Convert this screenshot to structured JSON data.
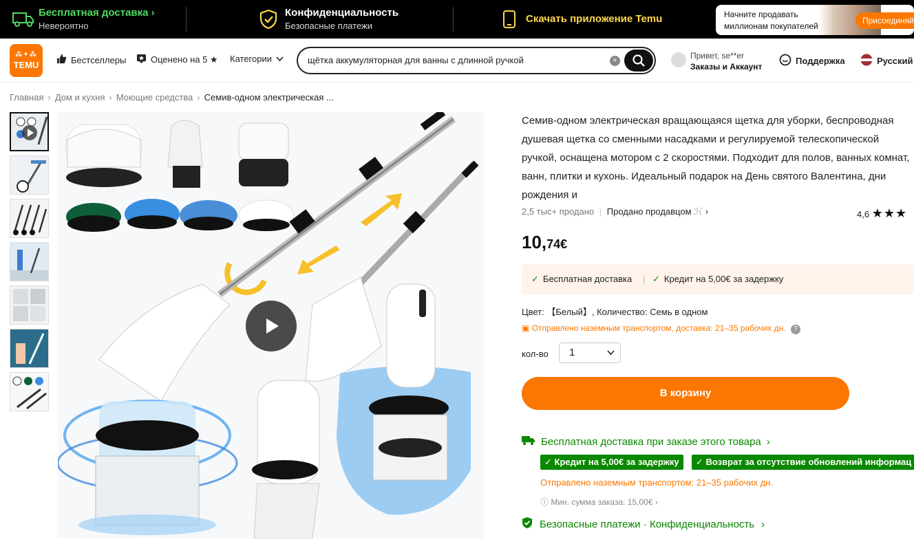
{
  "topbar": {
    "free_delivery": "Бесплатная доставка",
    "free_delivery_sub": "Невероятно",
    "privacy": "Конфиденциальность",
    "privacy_sub": "Безопасные платежи",
    "app": "Скачать приложение Temu",
    "seller_line1": "Начните продавать",
    "seller_line2": "миллионам покупателей ...",
    "join": "Присоединяй..."
  },
  "header": {
    "logo_top": "⁂✦⁂",
    "logo_text": "TEMU",
    "bestsellers": "Бестселлеры",
    "rated": "Оценено на 5 ★",
    "categories": "Категории",
    "search_query": "щётка аккумуляторная для ванны с длинной ручкой",
    "greeting": "Привет, se**er",
    "orders": "Заказы и Аккаунт",
    "support": "Поддержка",
    "language": "Русский"
  },
  "breadcrumb": [
    "Главная",
    "Дом и кухня",
    "Моющие средства",
    "Семив-одном электрическая ..."
  ],
  "product": {
    "title": "Семив-одном электрическая вращающаяся щетка для уборки, беспроводная душевая щетка со сменными насадками и регулируемой телескопической ручкой, оснащена мотором с 2 скоростями. Подходит для полов, ванных комнат, ванн, плитки и кухонь. Идеальный подарок на День святого Валентина, дни рождения и",
    "sold": "2,5 тыс+ продано",
    "sold_by": "Продано продавцом",
    "rating": "4,6",
    "stars": "★★★",
    "price_main": "10,",
    "price_cents": "74€",
    "perk1": "Бесплатная доставка",
    "perk2": "Кредит на 5,00€ за задержку",
    "color_line": "Цвет: 【Белый】, Количество: Семь в одном",
    "ship_line": "Отправлено наземным транспортом, доставка: 21–35 рабочих дн.",
    "qty_label": "кол-во",
    "qty_value": "1",
    "add_to_cart": "В корзину",
    "free_ship_order": "Бесплатная доставка при заказе этого товара",
    "badge1": "Кредит на 5,00€ за задержку",
    "badge2": "Возврат за отсутствие обновлений информац",
    "ship_line2": "Отправлено наземным транспортом: 21–35 рабочих дн.",
    "min_sum": "Мин. сумма заказа: 15,00€",
    "secure_pay": "Безопасные платежи",
    "privacy2": "Конфиденциальность"
  },
  "colors": {
    "accent": "#fb7701",
    "green": "#0a8800",
    "topbar_bg": "#000000"
  }
}
